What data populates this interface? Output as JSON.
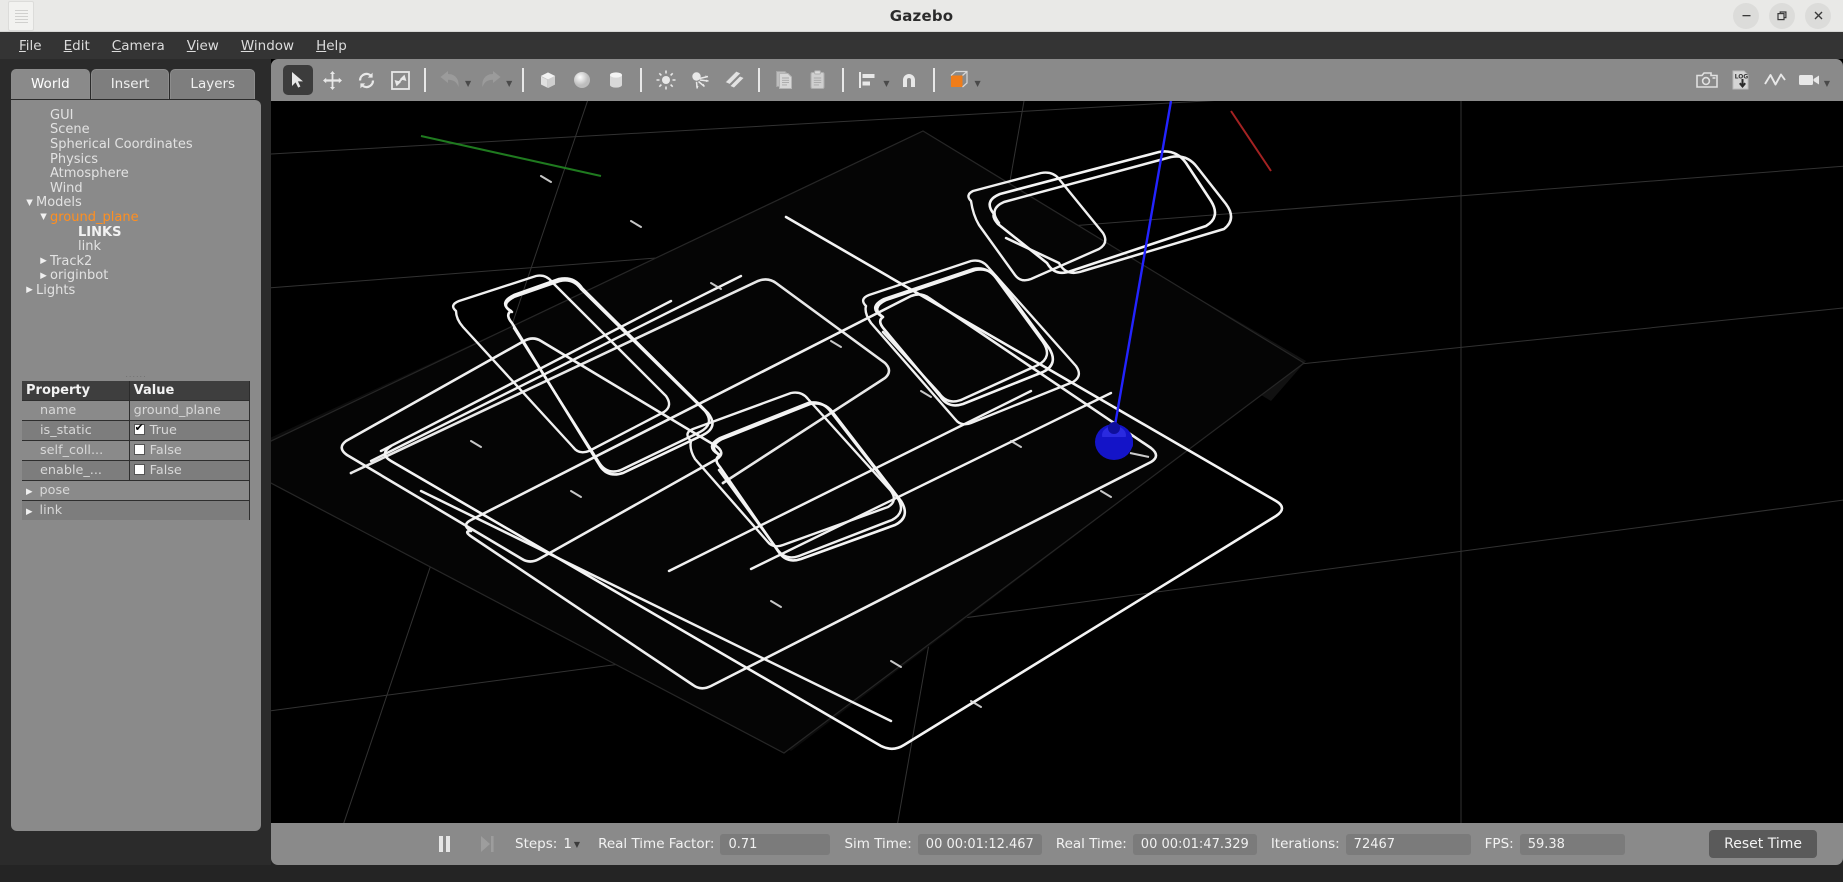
{
  "window": {
    "title": "Gazebo",
    "doc_icon": "document-icon",
    "controls": [
      {
        "name": "minimize-button",
        "glyph": "minimize-icon"
      },
      {
        "name": "maximize-button",
        "glyph": "maximize-icon"
      },
      {
        "name": "close-button",
        "glyph": "close-icon"
      }
    ]
  },
  "menubar": {
    "items": [
      {
        "label": "File",
        "mnemonic": "F"
      },
      {
        "label": "Edit",
        "mnemonic": "E"
      },
      {
        "label": "Camera",
        "mnemonic": "C"
      },
      {
        "label": "View",
        "mnemonic": "V"
      },
      {
        "label": "Window",
        "mnemonic": "W"
      },
      {
        "label": "Help",
        "mnemonic": "H"
      }
    ]
  },
  "left_panel": {
    "tabs": [
      {
        "label": "World",
        "active": true
      },
      {
        "label": "Insert",
        "active": false
      },
      {
        "label": "Layers",
        "active": false
      }
    ],
    "tree": [
      {
        "label": "GUI",
        "indent": 1,
        "arrow": "none",
        "selected": false,
        "bold": false
      },
      {
        "label": "Scene",
        "indent": 1,
        "arrow": "none",
        "selected": false,
        "bold": false
      },
      {
        "label": "Spherical Coordinates",
        "indent": 1,
        "arrow": "none",
        "selected": false,
        "bold": false
      },
      {
        "label": "Physics",
        "indent": 1,
        "arrow": "none",
        "selected": false,
        "bold": false
      },
      {
        "label": "Atmosphere",
        "indent": 1,
        "arrow": "none",
        "selected": false,
        "bold": false
      },
      {
        "label": "Wind",
        "indent": 1,
        "arrow": "none",
        "selected": false,
        "bold": false
      },
      {
        "label": "Models",
        "indent": 0,
        "arrow": "down",
        "selected": false,
        "bold": false
      },
      {
        "label": "ground_plane",
        "indent": 1,
        "arrow": "down",
        "selected": true,
        "bold": false
      },
      {
        "label": "LINKS",
        "indent": 3,
        "arrow": "none",
        "selected": false,
        "bold": true
      },
      {
        "label": "link",
        "indent": 3,
        "arrow": "none",
        "selected": false,
        "bold": false
      },
      {
        "label": "Track2",
        "indent": 1,
        "arrow": "right",
        "selected": false,
        "bold": false
      },
      {
        "label": "originbot",
        "indent": 1,
        "arrow": "right",
        "selected": false,
        "bold": false
      },
      {
        "label": "Lights",
        "indent": 0,
        "arrow": "right",
        "selected": false,
        "bold": false
      }
    ],
    "property_table": {
      "headers": [
        "Property",
        "Value"
      ],
      "rows": [
        {
          "key": "name",
          "value": "ground_plane",
          "type": "text",
          "alt": false
        },
        {
          "key": "is_static",
          "value": "True",
          "type": "checkbox",
          "checked": true,
          "alt": true
        },
        {
          "key": "self_coll...",
          "value": "False",
          "type": "checkbox",
          "checked": false,
          "alt": false
        },
        {
          "key": "enable_...",
          "value": "False",
          "type": "checkbox",
          "checked": false,
          "alt": true
        },
        {
          "key": "pose",
          "value": "",
          "type": "expand",
          "alt": false
        },
        {
          "key": "link",
          "value": "",
          "type": "expand",
          "alt": true
        }
      ]
    }
  },
  "toolbar": {
    "left_tools": [
      {
        "name": "select-mode-button",
        "icon": "cursor-arrow-icon",
        "active": true
      },
      {
        "name": "translate-mode-button",
        "icon": "move-arrows-icon",
        "active": false
      },
      {
        "name": "rotate-mode-button",
        "icon": "rotate-arrows-icon",
        "active": false
      },
      {
        "name": "scale-mode-button",
        "icon": "scale-arrows-icon",
        "active": false
      },
      {
        "name": "undo-button",
        "icon": "undo-arrow-icon",
        "active": false
      },
      {
        "name": "undo-history-dropdown",
        "icon": "chevron-down-icon",
        "active": false
      },
      {
        "name": "redo-button",
        "icon": "redo-arrow-icon",
        "active": false
      },
      {
        "name": "redo-history-dropdown",
        "icon": "chevron-down-icon",
        "active": false
      },
      {
        "name": "insert-box-button",
        "icon": "box-icon",
        "active": false
      },
      {
        "name": "insert-sphere-button",
        "icon": "sphere-icon",
        "active": false
      },
      {
        "name": "insert-cylinder-button",
        "icon": "cylinder-icon",
        "active": false
      },
      {
        "name": "insert-point-light-button",
        "icon": "point-light-icon",
        "active": false
      },
      {
        "name": "insert-spot-light-button",
        "icon": "spot-light-icon",
        "active": false
      },
      {
        "name": "insert-directional-light-button",
        "icon": "directional-light-icon",
        "active": false
      },
      {
        "name": "copy-button",
        "icon": "copy-icon",
        "active": false
      },
      {
        "name": "paste-button",
        "icon": "paste-icon",
        "active": false
      },
      {
        "name": "align-button",
        "icon": "align-icon",
        "active": false
      },
      {
        "name": "align-dropdown",
        "icon": "chevron-down-icon",
        "active": false
      },
      {
        "name": "snap-button",
        "icon": "magnet-icon",
        "active": false
      },
      {
        "name": "view-mode-button",
        "icon": "orange-cube-icon",
        "active": false
      },
      {
        "name": "view-mode-dropdown",
        "icon": "chevron-down-icon",
        "active": false
      }
    ],
    "right_tools": [
      {
        "name": "screenshot-button",
        "icon": "camera-icon"
      },
      {
        "name": "log-record-button",
        "icon": "log-download-icon"
      },
      {
        "name": "plot-button",
        "icon": "plot-line-icon"
      },
      {
        "name": "video-record-button",
        "icon": "video-camera-icon"
      }
    ],
    "accent_color": "#f07d1a"
  },
  "viewport": {
    "name": "gazebo-3d-viewport",
    "background": "#000000",
    "grid_color": "#3a3a3a",
    "ground_plane_color": "#0a0a0a",
    "track_line_color": "#f2f2f2",
    "robot_color": "#1a1ad0",
    "axis_z_color": "#2020ff",
    "axis_x_color": "#aa2222",
    "axis_y_color": "#228822"
  },
  "statusbar": {
    "pause_button": "pause-icon",
    "step_button": "step-forward-icon",
    "steps_label": "Steps:",
    "steps_value": "1",
    "rtf_label": "Real Time Factor:",
    "rtf_value": "0.71",
    "sim_time_label": "Sim Time:",
    "sim_time_value": "00 00:01:12.467",
    "real_time_label": "Real Time:",
    "real_time_value": "00 00:01:47.329",
    "iterations_label": "Iterations:",
    "iterations_value": "72467",
    "fps_label": "FPS:",
    "fps_value": "59.38",
    "reset_button": "Reset Time"
  }
}
